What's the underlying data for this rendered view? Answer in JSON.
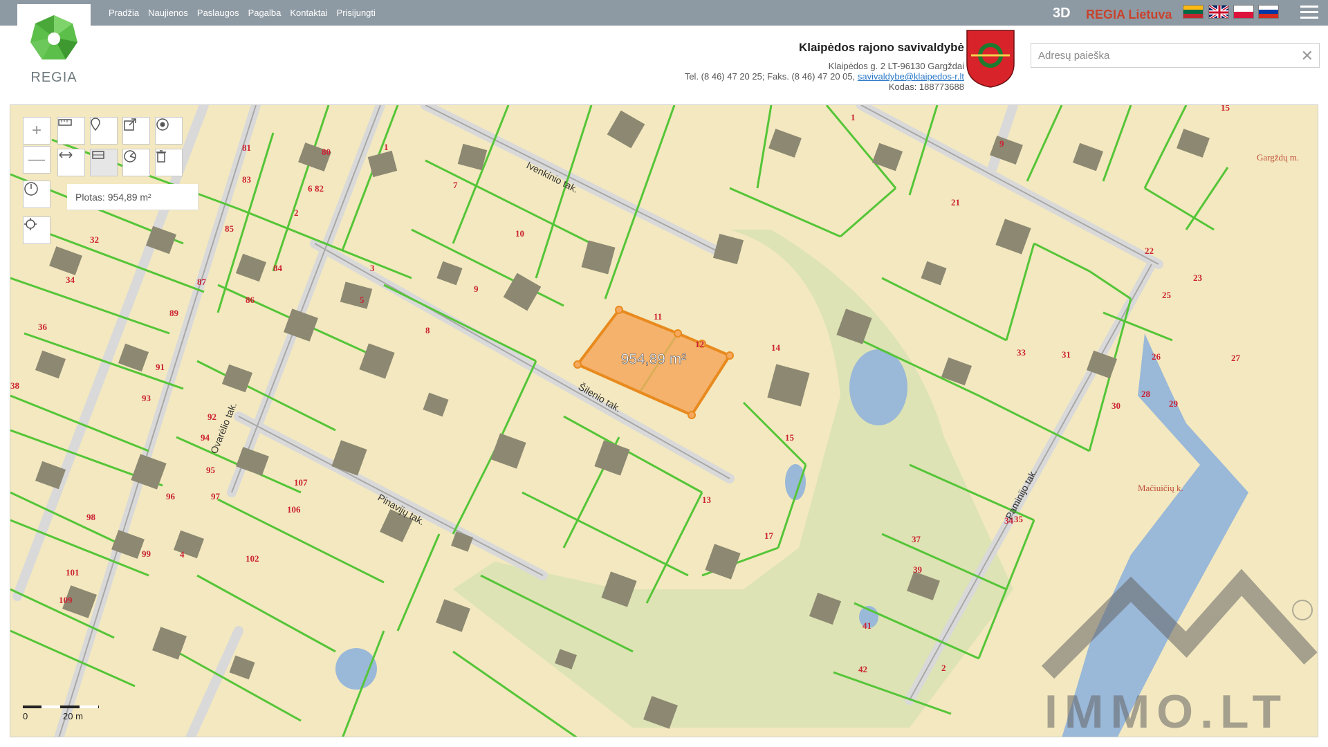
{
  "nav": {
    "items": [
      "Pradžia",
      "Naujienos",
      "Paslaugos",
      "Pagalba",
      "Kontaktai",
      "Prisijungti"
    ]
  },
  "logo": {
    "text": "REGIA"
  },
  "topright": {
    "btn3d": "3D",
    "brand": "REGIA Lietuva"
  },
  "municipality": {
    "name": "Klaipėdos rajono savivaldybė",
    "address": "Klaipėdos g. 2 LT-96130 Gargždai",
    "phone_fax": "Tel. (8 46) 47 20 25; Faks. (8 46) 47 20 05,",
    "email": "savivaldybe@klaipedos-r.lt",
    "code": "Kodas: 188773688"
  },
  "search": {
    "placeholder": "Adresų paieška",
    "value": ""
  },
  "map": {
    "area_readout": "Plotas: 954,89 m²",
    "selection_label": "954,89 m²",
    "scale": {
      "zero": "0",
      "dist": "20 m"
    },
    "streets": [
      "Ivenkinio tak.",
      "Šilenio tak.",
      "Ovarėlio tak.",
      "Pinavijų tak.",
      "Paminijo tak."
    ],
    "places": [
      "Gargždų m.",
      "Mačiuičių k."
    ],
    "parcel_numbers": [
      "81",
      "80",
      "1",
      "83",
      "82",
      "2",
      "85",
      "84",
      "32",
      "34",
      "87",
      "86",
      "89",
      "36",
      "91",
      "93",
      "38",
      "92",
      "94",
      "95",
      "96",
      "97",
      "98",
      "99",
      "101",
      "109",
      "106",
      "107",
      "102",
      "4",
      "6",
      "3",
      "5",
      "7",
      "8",
      "9",
      "10",
      "11",
      "12",
      "13",
      "14",
      "15",
      "17",
      "21",
      "22",
      "23",
      "25",
      "26",
      "27",
      "28",
      "29",
      "30",
      "31",
      "33",
      "34",
      "35",
      "37",
      "39",
      "41",
      "42",
      "2",
      "1",
      "9",
      "15"
    ],
    "watermark": "IMMO.LT",
    "colors": {
      "parcel_fill": "#f3e8bf",
      "parcel_line": "#55c538",
      "building": "#8c8872",
      "selection": "#f5a85e",
      "selection_line": "#e88a1e",
      "water": "#9ab8d8",
      "park": "#dde3b4",
      "label": "#cc2233"
    }
  }
}
